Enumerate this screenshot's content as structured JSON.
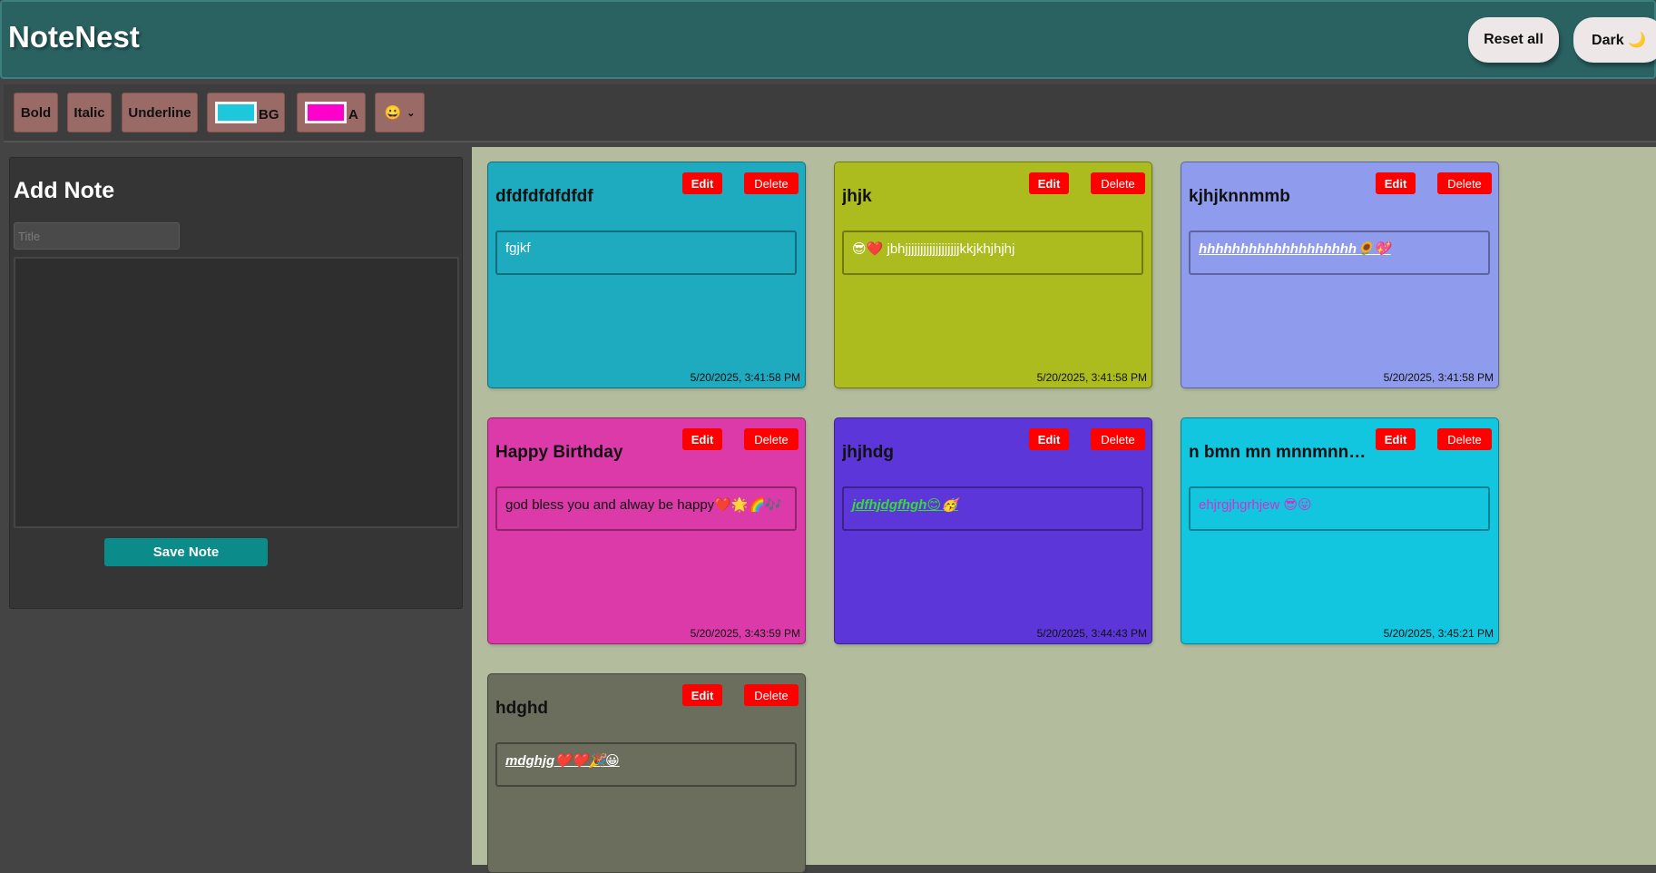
{
  "app": {
    "title": "NoteNest",
    "reset_label": "Reset all",
    "theme_label": "Dark 🌙"
  },
  "toolbar": {
    "bold_label": "Bold",
    "italic_label": "Italic",
    "underline_label": "Underline",
    "bg_label": "BG",
    "bg_color": "#1ec8dc",
    "text_color_label": "A",
    "text_color": "#ff00cc",
    "emoji_selected": "😀"
  },
  "sidebar": {
    "heading": "Add Note",
    "title_placeholder": "Title",
    "title_value": "",
    "body_value": "",
    "save_label": "Save Note"
  },
  "note_labels": {
    "edit": "Edit",
    "delete": "Delete"
  },
  "notes": [
    {
      "title": "dfdfdfdfdfdf",
      "body": "fgjkf",
      "timestamp": "5/20/2025, 3:41:58 PM",
      "bg": "#1eaabf",
      "body_color": "#ffffff",
      "body_style": "normal"
    },
    {
      "title": "jhjk",
      "body": "😎❤️ jbhjjjjjjjjjjjjjjjjjjkkjkhjhjhj",
      "timestamp": "5/20/2025, 3:41:58 PM",
      "bg": "#acbc1e",
      "body_color": "#ffffff",
      "body_style": "normal"
    },
    {
      "title": "kjhjknnmmb",
      "body": "hhhhhhhhhhhhhhhhhhh🌻💖",
      "timestamp": "5/20/2025, 3:41:58 PM",
      "bg": "#8f9ced",
      "body_color": "#ffffff",
      "body_style": "bold-italic-underline"
    },
    {
      "title": "Happy Birthday",
      "body": "god bless you and alway be happy❤️🌟🌈🎶",
      "timestamp": "5/20/2025, 3:43:59 PM",
      "bg": "#db3aa8",
      "body_color": "#111111",
      "body_style": "normal"
    },
    {
      "title": "jhjhdg",
      "body": "jdfhjdgfhgh😊🥳",
      "timestamp": "5/20/2025, 3:44:43 PM",
      "bg": "#5c36d8",
      "body_color": "#33dd33",
      "body_style": "bold-italic-underline"
    },
    {
      "title": "n bmn mn mnnmnnnmn",
      "body": "ehjrgjhgrhjew 😎😛",
      "timestamp": "5/20/2025, 3:45:21 PM",
      "bg": "#12c6e0",
      "body_color": "#cc33cc",
      "body_style": "normal"
    },
    {
      "title": "hdghd",
      "body": "mdghjg❤️❤️🎉😀",
      "timestamp": "",
      "bg": "#6b6e5d",
      "body_color": "#ffffff",
      "body_style": "bold-italic-underline"
    }
  ]
}
